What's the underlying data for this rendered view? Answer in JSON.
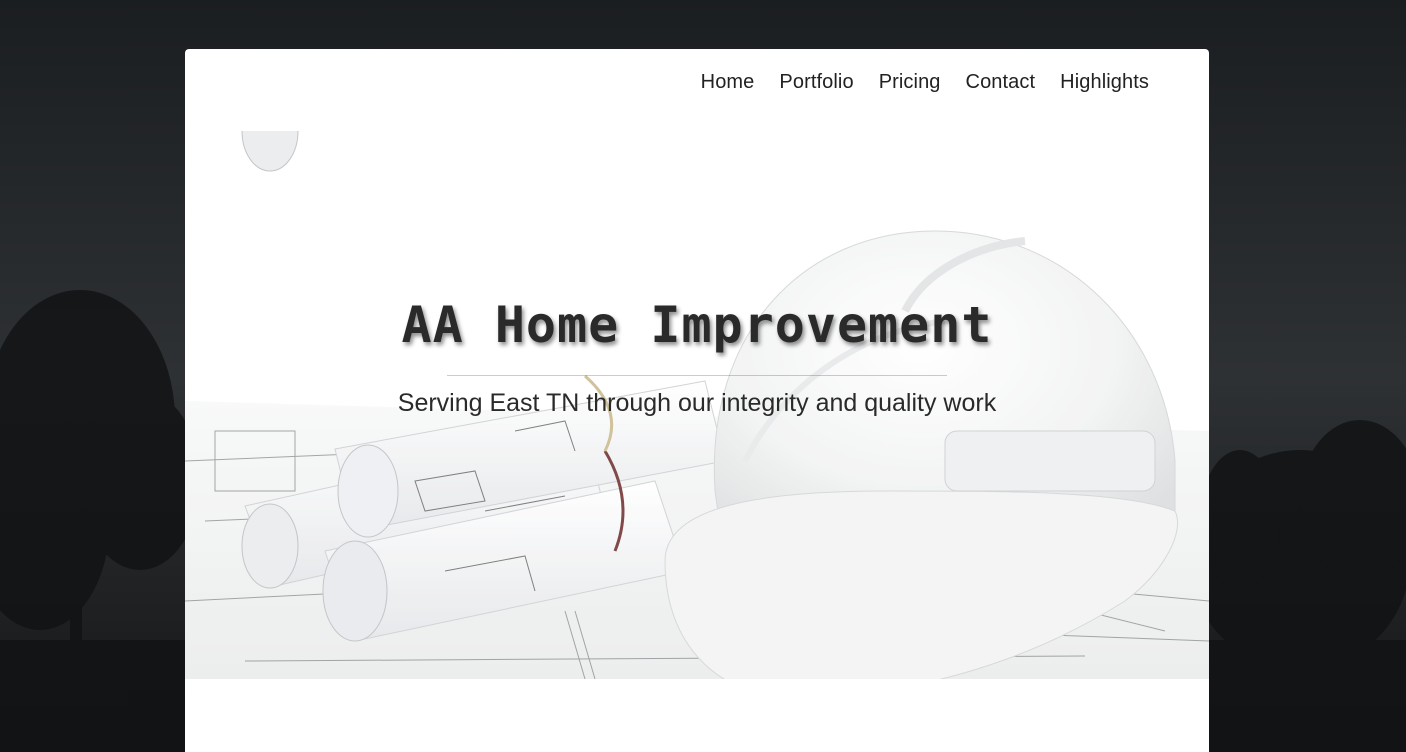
{
  "nav": {
    "items": [
      {
        "label": "Home"
      },
      {
        "label": "Portfolio"
      },
      {
        "label": "Pricing"
      },
      {
        "label": "Contact"
      },
      {
        "label": "Highlights"
      }
    ]
  },
  "hero": {
    "title": "AA Home Improvement",
    "subtitle": "Serving East TN through our integrity and quality work"
  },
  "colors": {
    "page_background": "#1c1f22",
    "card_background": "#ffffff",
    "text": "#2a2a2a"
  }
}
